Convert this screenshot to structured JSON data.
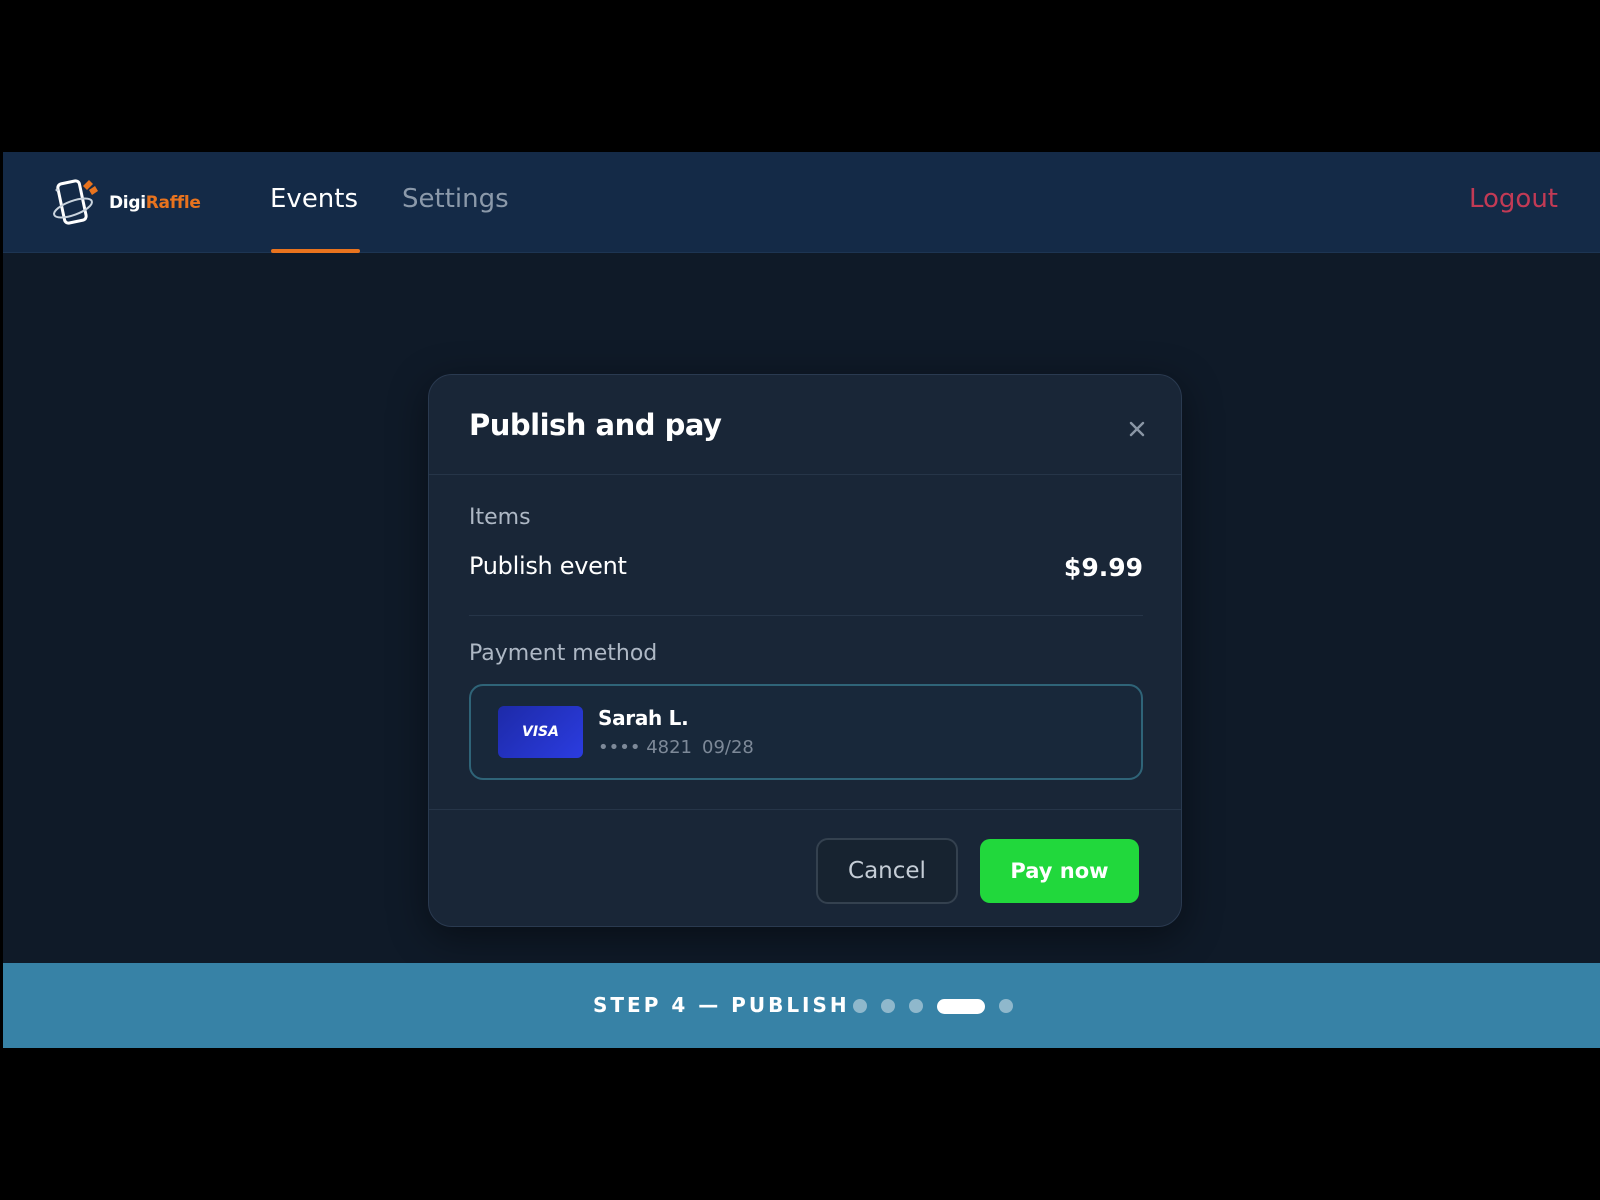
{
  "app": {
    "logo_text_primary": "Digi",
    "logo_text_accent": "Raffle",
    "accent_color": "#e8731e",
    "nav": {
      "tabs": [
        {
          "label": "Events",
          "active": true
        },
        {
          "label": "Settings",
          "active": false
        }
      ],
      "logout_label": "Logout"
    }
  },
  "modal": {
    "title": "Publish and pay",
    "close_icon": "close-icon",
    "items_label": "Items",
    "item": {
      "name": "Publish event",
      "price": "$9.99"
    },
    "payment_label": "Payment method",
    "card": {
      "brand": "VISA",
      "holder": "Sarah L.",
      "masked_number": "•••• 4821",
      "expiry": "09/28"
    },
    "buttons": {
      "cancel_label": "Cancel",
      "pay_label": "Pay now",
      "pay_color": "#21d83c"
    }
  },
  "step_footer": {
    "text": "STEP 4 — PUBLISH",
    "total_steps": 5,
    "current_step": 4
  }
}
